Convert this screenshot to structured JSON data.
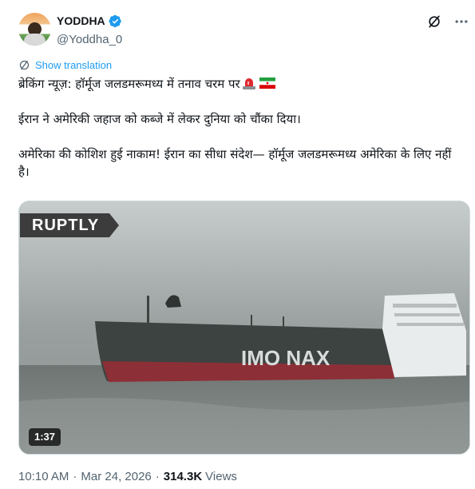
{
  "author": {
    "display_name": "YODDHA",
    "handle": "@Yoddha_0",
    "verified_color": "#1d9bf0"
  },
  "header_icons": [
    "grok-icon",
    "more-icon"
  ],
  "translation": {
    "label": "Show translation",
    "icon": "globe-translate-icon"
  },
  "tweet": {
    "line1": "ब्रेकिंग न्यूज़: हॉर्मूज जलडमरूमध्य में तनाव चरम पर",
    "line1_emojis": [
      "siren-emoji",
      "iran-flag-emoji"
    ],
    "line2": "ईरान ने अमेरिकी जहाज को कब्जे में लेकर दुनिया को चौंका दिया।",
    "line3": "अमेरिका की कोशिश हुई नाकाम! ईरान का सीधा संदेश— हॉर्मूज जलडमरूमध्य अमेरिका के लिए नहीं है।"
  },
  "media": {
    "watermark": "RUPTLY",
    "duration": "1:37",
    "ship_hull_text": "IMO NAX"
  },
  "meta": {
    "time": "10:10 AM",
    "separator": "·",
    "date": "Mar 24, 2026",
    "views_count": "314.3K",
    "views_label": "Views"
  },
  "colors": {
    "accent": "#1d9bf0",
    "text_primary": "#0f1419",
    "text_secondary": "#536471"
  }
}
